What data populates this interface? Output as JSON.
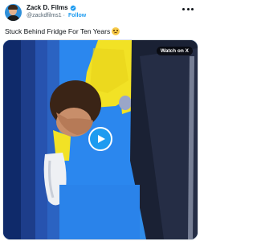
{
  "author": {
    "name": "Zack D. Films",
    "handle": "@zackdfilms1",
    "separator": "·",
    "follow_label": "Follow",
    "avatar_icon": "profile-photo",
    "verified_color": "#1d9bf0"
  },
  "tweet": {
    "text": "Stuck Behind Fridge For Ten Years",
    "emoji_icon": "anxious-face-emoji"
  },
  "media": {
    "watch_label": "Watch on X",
    "play_icon": "play-icon"
  },
  "colors": {
    "accent": "#1d9bf0",
    "video_background": "#2c86e8",
    "shirt": "#f2e225"
  }
}
